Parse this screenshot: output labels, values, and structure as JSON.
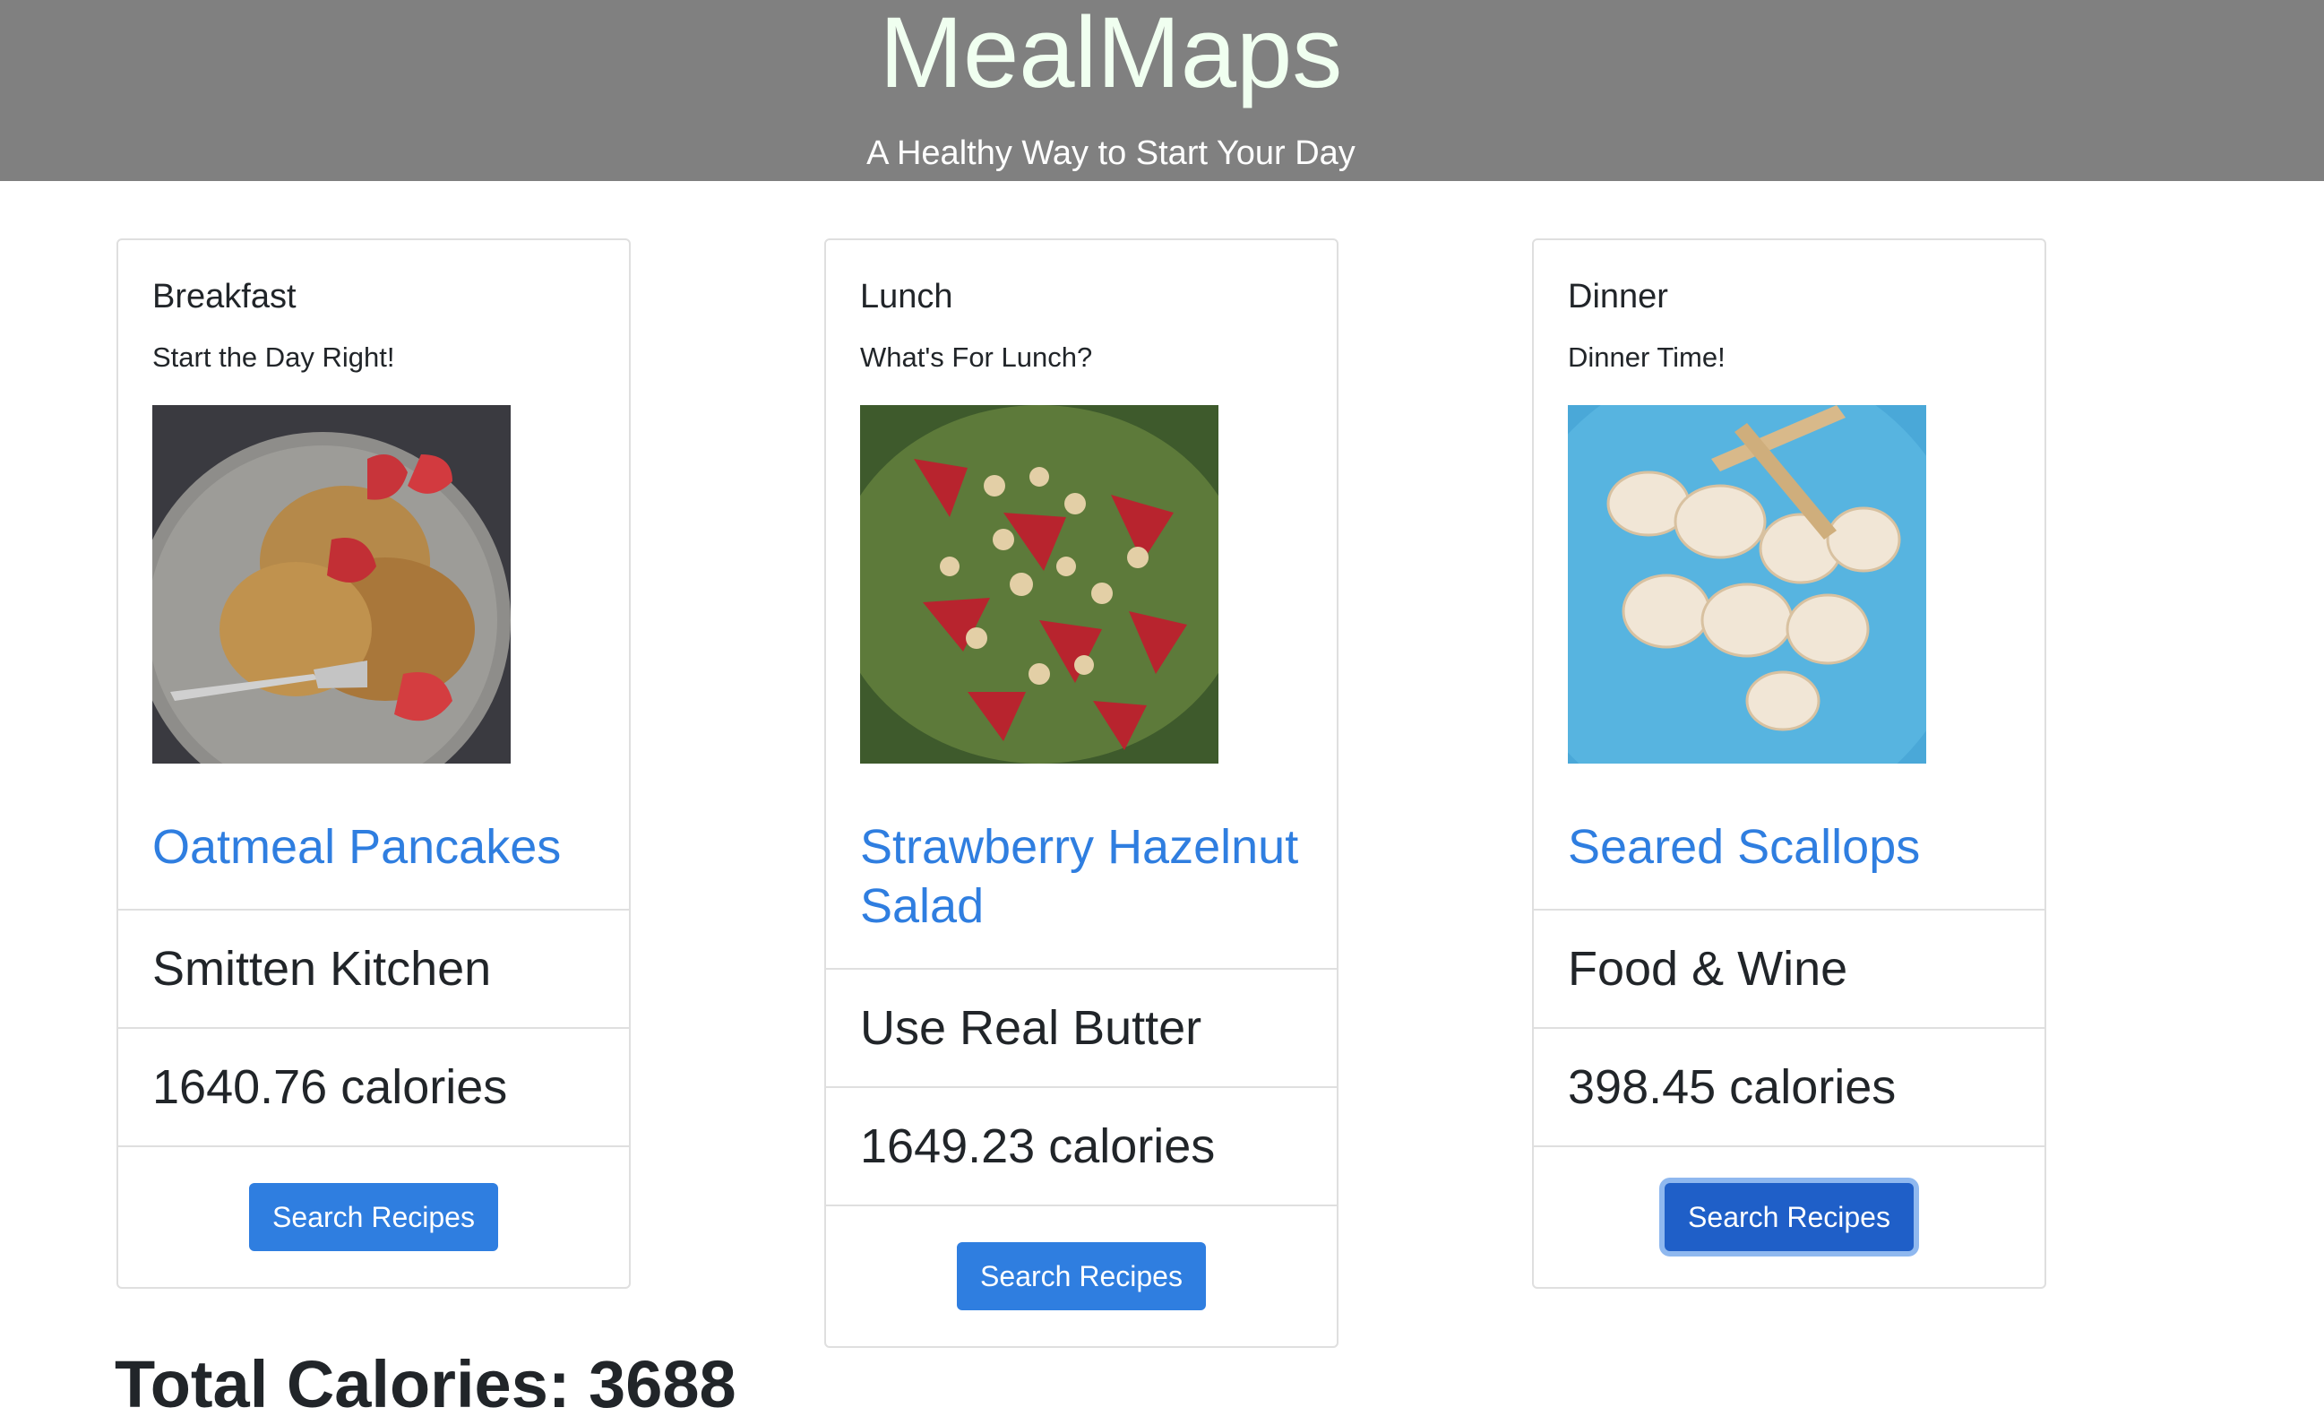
{
  "header": {
    "title": "MealMaps",
    "tagline": "A Healthy Way to Start Your Day"
  },
  "cards": [
    {
      "meal": "Breakfast",
      "subtitle": "Start the Day Right!",
      "image_icon": "pancakes-with-strawberries-photo",
      "recipe": "Oatmeal Pancakes",
      "source": "Smitten Kitchen",
      "calories": "1640.76 calories",
      "button": "Search Recipes"
    },
    {
      "meal": "Lunch",
      "subtitle": "What's For Lunch?",
      "image_icon": "strawberry-hazelnut-salad-photo",
      "recipe": "Strawberry Hazelnut Salad",
      "source": "Use Real Butter",
      "calories": "1649.23 calories",
      "button": "Search Recipes"
    },
    {
      "meal": "Dinner",
      "subtitle": "Dinner Time!",
      "image_icon": "seared-scallops-photo",
      "recipe": "Seared Scallops",
      "source": "Food & Wine",
      "calories": "398.45 calories",
      "button": "Search Recipes"
    }
  ],
  "colors": {
    "header_bg": "#808080",
    "brand_text": "#f0fff0",
    "link": "#2f7ee0",
    "button": "#2f7ee0"
  },
  "total": {
    "label": "Total Calories: 3688"
  }
}
